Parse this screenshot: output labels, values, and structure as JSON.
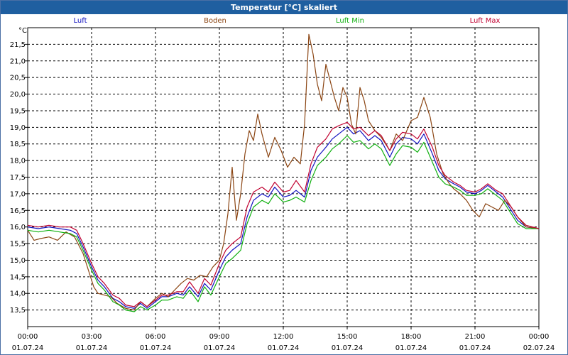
{
  "window": {
    "title": "Temperatur [°C] skaliert"
  },
  "chart_data": {
    "type": "line",
    "title": "Temperatur [°C] skaliert",
    "ylabel": "°C",
    "xlabel": "",
    "ylim": [
      13.0,
      22.0
    ],
    "xlim": [
      0,
      24
    ],
    "grid": true,
    "legend_position": "top",
    "y_ticks": [
      "13,5",
      "14,0",
      "14,5",
      "15,0",
      "15,5",
      "16,0",
      "16,5",
      "17,0",
      "17,5",
      "18,0",
      "18,5",
      "19,0",
      "19,5",
      "20,0",
      "20,5",
      "21,0",
      "21,5"
    ],
    "x_ticks": [
      {
        "time": "00:00",
        "date": "01.07.24"
      },
      {
        "time": "03:00",
        "date": "01.07.24"
      },
      {
        "time": "06:00",
        "date": "01.07.24"
      },
      {
        "time": "09:00",
        "date": "01.07.24"
      },
      {
        "time": "12:00",
        "date": "01.07.24"
      },
      {
        "time": "15:00",
        "date": "01.07.24"
      },
      {
        "time": "18:00",
        "date": "01.07.24"
      },
      {
        "time": "21:00",
        "date": "01.07.24"
      },
      {
        "time": "00:00",
        "date": "02.07.24"
      }
    ],
    "series": [
      {
        "name": "Luft",
        "color": "#1010c0",
        "points": [
          [
            0,
            16.0
          ],
          [
            0.5,
            15.95
          ],
          [
            1,
            16.0
          ],
          [
            1.5,
            15.95
          ],
          [
            2,
            15.9
          ],
          [
            2.3,
            15.8
          ],
          [
            2.6,
            15.4
          ],
          [
            3,
            14.8
          ],
          [
            3.3,
            14.4
          ],
          [
            3.6,
            14.2
          ],
          [
            4,
            13.85
          ],
          [
            4.3,
            13.75
          ],
          [
            4.6,
            13.6
          ],
          [
            5,
            13.55
          ],
          [
            5.3,
            13.7
          ],
          [
            5.6,
            13.55
          ],
          [
            6,
            13.75
          ],
          [
            6.3,
            13.9
          ],
          [
            6.6,
            13.9
          ],
          [
            7,
            14.0
          ],
          [
            7.3,
            13.95
          ],
          [
            7.6,
            14.2
          ],
          [
            8,
            13.9
          ],
          [
            8.3,
            14.3
          ],
          [
            8.6,
            14.1
          ],
          [
            9,
            14.7
          ],
          [
            9.3,
            15.1
          ],
          [
            9.6,
            15.3
          ],
          [
            10,
            15.5
          ],
          [
            10.3,
            16.3
          ],
          [
            10.6,
            16.8
          ],
          [
            11,
            17.0
          ],
          [
            11.3,
            16.9
          ],
          [
            11.6,
            17.2
          ],
          [
            12,
            16.9
          ],
          [
            12.3,
            16.95
          ],
          [
            12.6,
            17.1
          ],
          [
            13,
            16.9
          ],
          [
            13.3,
            17.7
          ],
          [
            13.6,
            18.1
          ],
          [
            14,
            18.4
          ],
          [
            14.3,
            18.65
          ],
          [
            14.6,
            18.8
          ],
          [
            15,
            19.0
          ],
          [
            15.3,
            18.8
          ],
          [
            15.6,
            18.9
          ],
          [
            16,
            18.6
          ],
          [
            16.3,
            18.75
          ],
          [
            16.6,
            18.6
          ],
          [
            17,
            18.1
          ],
          [
            17.3,
            18.5
          ],
          [
            17.6,
            18.7
          ],
          [
            18,
            18.65
          ],
          [
            18.3,
            18.5
          ],
          [
            18.6,
            18.8
          ],
          [
            19,
            18.2
          ],
          [
            19.3,
            17.7
          ],
          [
            19.6,
            17.45
          ],
          [
            20,
            17.3
          ],
          [
            20.3,
            17.2
          ],
          [
            20.6,
            17.05
          ],
          [
            21,
            17.0
          ],
          [
            21.3,
            17.1
          ],
          [
            21.6,
            17.25
          ],
          [
            22,
            17.05
          ],
          [
            22.3,
            16.9
          ],
          [
            22.6,
            16.6
          ],
          [
            23,
            16.2
          ],
          [
            23.4,
            16.0
          ],
          [
            24,
            15.95
          ]
        ]
      },
      {
        "name": "Boden",
        "color": "#8b4513",
        "points": [
          [
            0,
            15.9
          ],
          [
            0.3,
            15.6
          ],
          [
            0.6,
            15.65
          ],
          [
            1,
            15.7
          ],
          [
            1.4,
            15.6
          ],
          [
            1.8,
            15.85
          ],
          [
            2.2,
            15.7
          ],
          [
            2.6,
            15.2
          ],
          [
            2.9,
            14.6
          ],
          [
            3.1,
            14.2
          ],
          [
            3.3,
            14.0
          ],
          [
            3.6,
            13.95
          ],
          [
            3.9,
            13.9
          ],
          [
            4.2,
            13.7
          ],
          [
            4.6,
            13.55
          ],
          [
            5,
            13.5
          ],
          [
            5.3,
            13.75
          ],
          [
            5.6,
            13.6
          ],
          [
            6,
            13.85
          ],
          [
            6.3,
            14.0
          ],
          [
            6.6,
            13.9
          ],
          [
            6.9,
            14.1
          ],
          [
            7.2,
            14.3
          ],
          [
            7.5,
            14.45
          ],
          [
            7.8,
            14.4
          ],
          [
            8.1,
            14.55
          ],
          [
            8.4,
            14.5
          ],
          [
            8.7,
            14.8
          ],
          [
            9,
            15.0
          ],
          [
            9.2,
            15.5
          ],
          [
            9.4,
            16.4
          ],
          [
            9.6,
            17.8
          ],
          [
            9.8,
            16.2
          ],
          [
            10,
            17.0
          ],
          [
            10.2,
            18.2
          ],
          [
            10.4,
            18.9
          ],
          [
            10.6,
            18.6
          ],
          [
            10.8,
            19.4
          ],
          [
            11,
            18.8
          ],
          [
            11.3,
            18.1
          ],
          [
            11.6,
            18.7
          ],
          [
            11.9,
            18.3
          ],
          [
            12.2,
            17.8
          ],
          [
            12.5,
            18.1
          ],
          [
            12.8,
            17.9
          ],
          [
            13,
            19.1
          ],
          [
            13.2,
            21.8
          ],
          [
            13.4,
            21.2
          ],
          [
            13.6,
            20.3
          ],
          [
            13.8,
            19.8
          ],
          [
            14,
            20.9
          ],
          [
            14.2,
            20.4
          ],
          [
            14.4,
            19.9
          ],
          [
            14.6,
            19.5
          ],
          [
            14.8,
            20.2
          ],
          [
            15,
            19.9
          ],
          [
            15.2,
            19.1
          ],
          [
            15.4,
            18.8
          ],
          [
            15.6,
            20.2
          ],
          [
            15.8,
            19.8
          ],
          [
            16,
            19.2
          ],
          [
            16.3,
            18.9
          ],
          [
            16.6,
            18.7
          ],
          [
            17,
            18.3
          ],
          [
            17.3,
            18.8
          ],
          [
            17.6,
            18.6
          ],
          [
            18,
            19.2
          ],
          [
            18.3,
            19.3
          ],
          [
            18.6,
            19.9
          ],
          [
            18.9,
            19.3
          ],
          [
            19.2,
            18.2
          ],
          [
            19.5,
            17.6
          ],
          [
            19.8,
            17.3
          ],
          [
            20,
            17.15
          ],
          [
            20.3,
            17.0
          ],
          [
            20.6,
            16.8
          ],
          [
            20.9,
            16.5
          ],
          [
            21.2,
            16.3
          ],
          [
            21.5,
            16.7
          ],
          [
            21.8,
            16.6
          ],
          [
            22.1,
            16.5
          ],
          [
            22.4,
            16.8
          ],
          [
            22.7,
            16.6
          ],
          [
            23,
            16.3
          ],
          [
            23.4,
            16.0
          ],
          [
            24,
            15.95
          ]
        ]
      },
      {
        "name": "Luft Min",
        "color": "#10b010",
        "points": [
          [
            0,
            15.9
          ],
          [
            0.5,
            15.85
          ],
          [
            1,
            15.9
          ],
          [
            1.5,
            15.85
          ],
          [
            2,
            15.8
          ],
          [
            2.3,
            15.7
          ],
          [
            2.6,
            15.3
          ],
          [
            3,
            14.7
          ],
          [
            3.3,
            14.3
          ],
          [
            3.6,
            14.1
          ],
          [
            4,
            13.75
          ],
          [
            4.3,
            13.65
          ],
          [
            4.6,
            13.5
          ],
          [
            5,
            13.45
          ],
          [
            5.3,
            13.6
          ],
          [
            5.6,
            13.5
          ],
          [
            6,
            13.65
          ],
          [
            6.3,
            13.8
          ],
          [
            6.6,
            13.8
          ],
          [
            7,
            13.9
          ],
          [
            7.3,
            13.85
          ],
          [
            7.6,
            14.1
          ],
          [
            8,
            13.75
          ],
          [
            8.3,
            14.2
          ],
          [
            8.6,
            13.95
          ],
          [
            9,
            14.5
          ],
          [
            9.3,
            14.9
          ],
          [
            9.6,
            15.05
          ],
          [
            10,
            15.3
          ],
          [
            10.3,
            16.1
          ],
          [
            10.6,
            16.6
          ],
          [
            11,
            16.8
          ],
          [
            11.3,
            16.7
          ],
          [
            11.6,
            17.0
          ],
          [
            12,
            16.75
          ],
          [
            12.3,
            16.8
          ],
          [
            12.6,
            16.9
          ],
          [
            13,
            16.75
          ],
          [
            13.3,
            17.4
          ],
          [
            13.6,
            17.85
          ],
          [
            14,
            18.1
          ],
          [
            14.3,
            18.35
          ],
          [
            14.6,
            18.5
          ],
          [
            15,
            18.75
          ],
          [
            15.3,
            18.55
          ],
          [
            15.6,
            18.6
          ],
          [
            16,
            18.35
          ],
          [
            16.3,
            18.5
          ],
          [
            16.6,
            18.35
          ],
          [
            17,
            17.85
          ],
          [
            17.3,
            18.2
          ],
          [
            17.6,
            18.45
          ],
          [
            18,
            18.4
          ],
          [
            18.3,
            18.25
          ],
          [
            18.6,
            18.55
          ],
          [
            19,
            17.95
          ],
          [
            19.3,
            17.5
          ],
          [
            19.6,
            17.3
          ],
          [
            20,
            17.2
          ],
          [
            20.3,
            17.1
          ],
          [
            20.6,
            16.95
          ],
          [
            21,
            16.95
          ],
          [
            21.3,
            17.0
          ],
          [
            21.6,
            17.15
          ],
          [
            22,
            16.95
          ],
          [
            22.3,
            16.8
          ],
          [
            22.6,
            16.5
          ],
          [
            23,
            16.1
          ],
          [
            23.4,
            15.95
          ],
          [
            24,
            15.95
          ]
        ]
      },
      {
        "name": "Luft Max",
        "color": "#c00030",
        "points": [
          [
            0,
            16.05
          ],
          [
            0.5,
            16.0
          ],
          [
            1,
            16.05
          ],
          [
            1.5,
            16.0
          ],
          [
            2,
            16.0
          ],
          [
            2.3,
            15.9
          ],
          [
            2.6,
            15.5
          ],
          [
            3,
            14.9
          ],
          [
            3.3,
            14.5
          ],
          [
            3.6,
            14.3
          ],
          [
            4,
            13.95
          ],
          [
            4.3,
            13.85
          ],
          [
            4.6,
            13.65
          ],
          [
            5,
            13.6
          ],
          [
            5.3,
            13.75
          ],
          [
            5.6,
            13.6
          ],
          [
            6,
            13.8
          ],
          [
            6.3,
            13.95
          ],
          [
            6.6,
            13.95
          ],
          [
            7,
            14.05
          ],
          [
            7.3,
            14.05
          ],
          [
            7.6,
            14.35
          ],
          [
            8,
            14.0
          ],
          [
            8.3,
            14.45
          ],
          [
            8.6,
            14.25
          ],
          [
            9,
            14.9
          ],
          [
            9.3,
            15.3
          ],
          [
            9.6,
            15.5
          ],
          [
            10,
            15.7
          ],
          [
            10.3,
            16.6
          ],
          [
            10.6,
            17.05
          ],
          [
            11,
            17.2
          ],
          [
            11.3,
            17.05
          ],
          [
            11.6,
            17.35
          ],
          [
            12,
            17.05
          ],
          [
            12.3,
            17.1
          ],
          [
            12.6,
            17.4
          ],
          [
            13,
            17.05
          ],
          [
            13.3,
            17.9
          ],
          [
            13.6,
            18.4
          ],
          [
            14,
            18.65
          ],
          [
            14.3,
            18.95
          ],
          [
            14.6,
            19.05
          ],
          [
            15,
            19.15
          ],
          [
            15.3,
            18.95
          ],
          [
            15.6,
            19.0
          ],
          [
            16,
            18.75
          ],
          [
            16.3,
            18.9
          ],
          [
            16.6,
            18.75
          ],
          [
            17,
            18.3
          ],
          [
            17.3,
            18.65
          ],
          [
            17.6,
            18.85
          ],
          [
            18,
            18.8
          ],
          [
            18.3,
            18.65
          ],
          [
            18.6,
            18.95
          ],
          [
            19,
            18.4
          ],
          [
            19.3,
            17.85
          ],
          [
            19.6,
            17.55
          ],
          [
            20,
            17.35
          ],
          [
            20.3,
            17.25
          ],
          [
            20.6,
            17.1
          ],
          [
            21,
            17.05
          ],
          [
            21.3,
            17.15
          ],
          [
            21.6,
            17.3
          ],
          [
            22,
            17.1
          ],
          [
            22.3,
            17.0
          ],
          [
            22.6,
            16.7
          ],
          [
            23,
            16.3
          ],
          [
            23.4,
            16.05
          ],
          [
            24,
            15.95
          ]
        ]
      }
    ]
  }
}
